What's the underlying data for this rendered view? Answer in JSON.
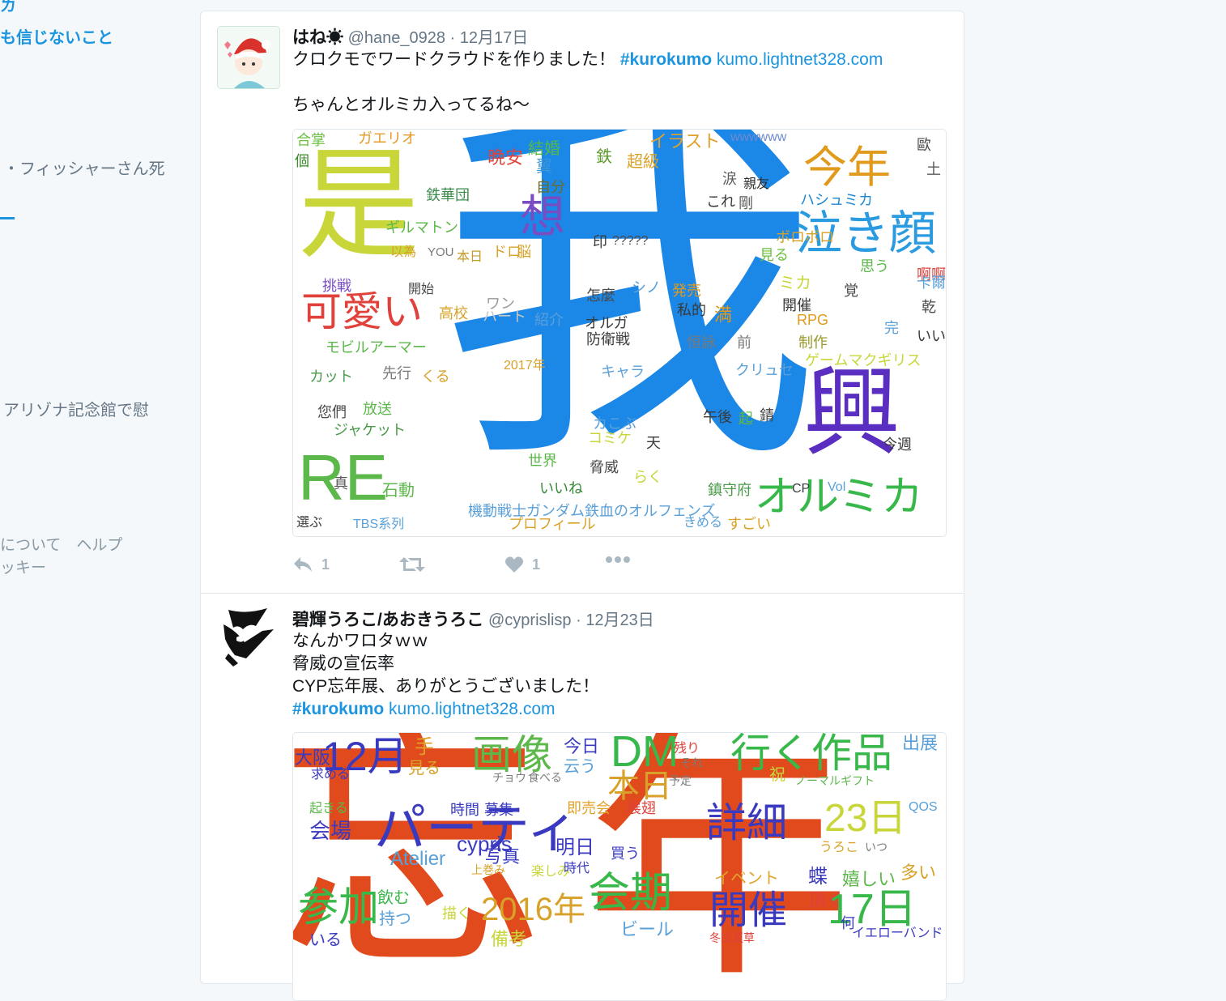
{
  "sidebar": {
    "t1": "ㄌ",
    "t2": "も信じないこと",
    "t3": "・フィッシャーさん死",
    "t4": "アリゾナ記念館で慰",
    "t5": "について　ヘルプ",
    "t6": "ッキー"
  },
  "tweets": [
    {
      "name": "はね☀",
      "handle": "@hane_0928",
      "sep": " · ",
      "date": "12月17日",
      "line1_text": "クロクモでワードクラウドを作りました！ ",
      "hashtag": "#kurokumo",
      "link": " kumo.lightnet328.com",
      "line2": "ちゃんとオルミカ入ってるね～",
      "reply_count": "1",
      "like_count": "1"
    },
    {
      "name": "碧輝うろこ/あおきうろこ",
      "handle": "@cyprislisp",
      "sep": " · ",
      "date": "12月23日",
      "line1": "なんかワロタｗｗ",
      "line2": "脅威の宣伝率",
      "line3": "CYP忘年展、ありがとうございました！",
      "hashtag": " #kurokumo",
      "link": " kumo.lightnet328.com"
    }
  ],
  "cloud1": {
    "big": [
      "我",
      "是",
      "泣き顔",
      "今年",
      "可愛い",
      "オルミカ",
      "想",
      "興"
    ],
    "words": [
      "合掌",
      "ガエリオ",
      "晩安",
      "結婚",
      "翼",
      "鉄",
      "超級",
      "イラスト",
      "wwwwww",
      "歐",
      "個",
      "鉄華団",
      "自分",
      "ハシュミカ",
      "親友",
      "剛",
      "ギルマトン",
      "以為",
      "YOU",
      "本日",
      "ドロ",
      "脳",
      "印",
      "?????",
      "見る",
      "ボロボロ",
      "挑戦",
      "開始",
      "高校",
      "ワン",
      "ハート",
      "紹介",
      "怎麼",
      "シノ",
      "発売",
      "私的",
      "開催",
      "RPG",
      "啊啊",
      "モビルアーマー",
      "オルガ",
      "防衛戦",
      "恒詠",
      "前",
      "制作",
      "ゲームマクギリス",
      "カット",
      "先行",
      "くる",
      "2017年",
      "キャラ",
      "クリュセ",
      "放送",
      "您們",
      "ジャケット",
      "カこぶ",
      "午後",
      "起",
      "錆",
      "コミケ",
      "天",
      "今週",
      "世界",
      "いいね",
      "脅威",
      "らく",
      "鎮守府",
      "真",
      "石動",
      "機動戦士ガンダム鉄血のオルフェンズ",
      "選ぶ",
      "TBS系列",
      "プロフィール",
      "きめる",
      "すごい",
      "Vol",
      "CP",
      "完",
      "いい",
      "乾",
      "卡爾",
      "土",
      "涙",
      "これ",
      "RE",
      "ミカ",
      "覚",
      "思う",
      "満"
    ]
  },
  "cloud2": {
    "big": [
      "忘",
      "年",
      "パーティ",
      "画像",
      "DM",
      "12月",
      "行く",
      "作品",
      "本日",
      "詳細",
      "23日",
      "会期",
      "参加",
      "開催",
      "17日",
      "2016年"
    ],
    "words": [
      "出展",
      "手",
      "今日",
      "云う",
      "見る",
      "求める",
      "残り",
      "それ",
      "予定",
      "祝",
      "ノーマルギフト",
      "時間",
      "募集",
      "即売会",
      "展翅",
      "会場",
      "cypris",
      "写真",
      "明日",
      "買う",
      "イベント",
      "蝶",
      "嬉しい",
      "頂く",
      "Atelier",
      "飲む",
      "持つ",
      "描く",
      "備考",
      "ビール",
      "冬虫夏草",
      "イエローバンド",
      "多い",
      "起きる",
      "いる",
      "うろこ",
      "いつ",
      "楽しみ",
      "時代",
      "QOS",
      "大阪",
      "チョウ",
      "食べる",
      "上巻み",
      "何"
    ]
  }
}
